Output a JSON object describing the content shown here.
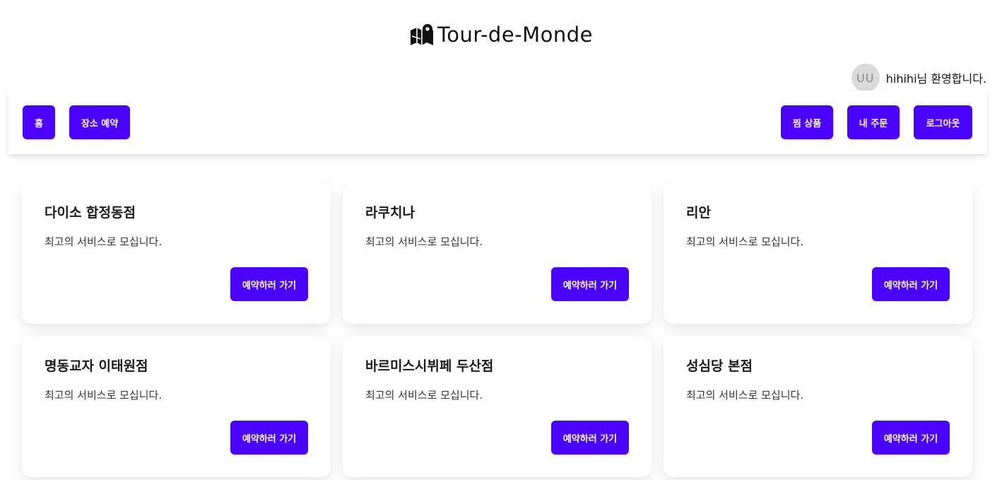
{
  "brand": {
    "title": "Tour-de-Monde",
    "icon": "map-pin-icon"
  },
  "user": {
    "avatar_initials": "UU",
    "welcome_text": "hihihi님 환영합니다."
  },
  "nav": {
    "left": [
      {
        "label": "홈"
      },
      {
        "label": "장소 예약"
      }
    ],
    "right": [
      {
        "label": "찜 상품"
      },
      {
        "label": "내 주문"
      },
      {
        "label": "로그아웃"
      }
    ]
  },
  "colors": {
    "accent": "#4a03ff",
    "avatar_bg": "#d9d9d9"
  },
  "cards": [
    {
      "title": "다이소 합정동점",
      "description": "최고의 서비스로 모십니다.",
      "button_label": "예약하러 가기"
    },
    {
      "title": "라쿠치나",
      "description": "최고의 서비스로 모십니다.",
      "button_label": "예약하러 가기"
    },
    {
      "title": "리안",
      "description": "최고의 서비스로 모십니다.",
      "button_label": "예약하러 가기"
    },
    {
      "title": "명동교자 이태원점",
      "description": "최고의 서비스로 모십니다.",
      "button_label": "예약하러 가기"
    },
    {
      "title": "바르미스시뷔페 두산점",
      "description": "최고의 서비스로 모십니다.",
      "button_label": "예약하러 가기"
    },
    {
      "title": "성심당 본점",
      "description": "최고의 서비스로 모십니다.",
      "button_label": "예약하러 가기"
    }
  ]
}
